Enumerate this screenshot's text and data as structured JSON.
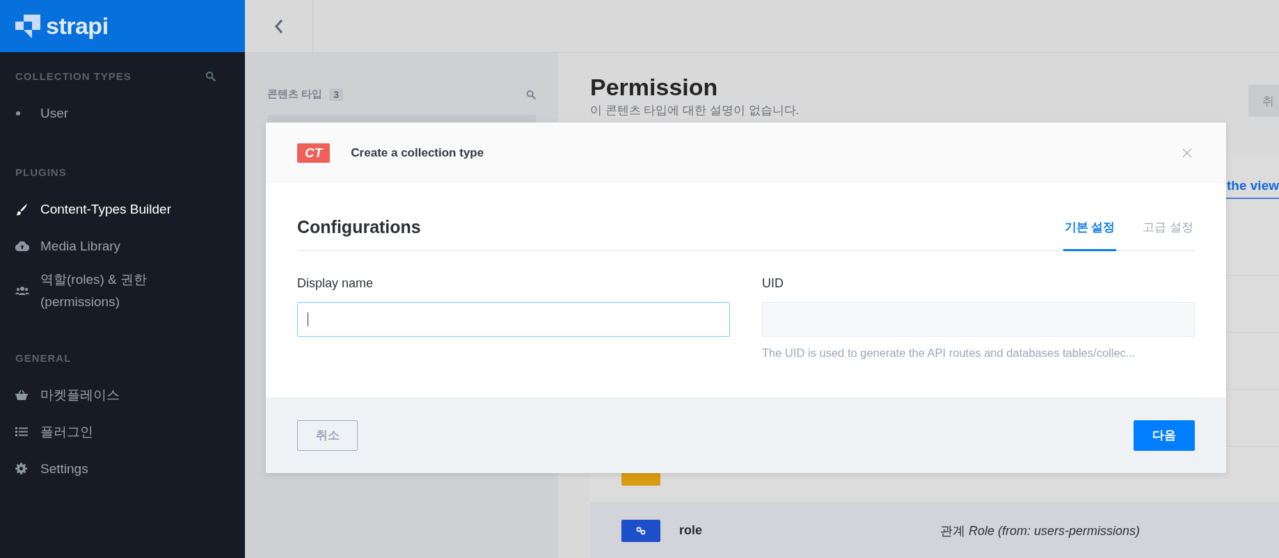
{
  "sidebar": {
    "logo": "strapi",
    "sections": [
      {
        "title": "COLLECTION TYPES",
        "searchable": true,
        "items": [
          {
            "label": "User",
            "kind": "bullet",
            "selected": false
          }
        ]
      },
      {
        "title": "PLUGINS",
        "searchable": false,
        "items": [
          {
            "label": "Content-Types Builder",
            "kind": "brush",
            "selected": true
          },
          {
            "label": "Media Library",
            "kind": "cloud",
            "selected": false
          },
          {
            "label": "역할(roles) & 권한 (permissions)",
            "kind": "users",
            "selected": false
          }
        ]
      },
      {
        "title": "GENERAL",
        "searchable": false,
        "items": [
          {
            "label": "마켓플레이스",
            "kind": "basket",
            "selected": false
          },
          {
            "label": "플러그인",
            "kind": "list",
            "selected": false
          },
          {
            "label": "Settings",
            "kind": "gear",
            "selected": false
          }
        ]
      }
    ]
  },
  "types_panel": {
    "title": "콘텐츠 타입",
    "count": "3"
  },
  "page": {
    "title": "Permission",
    "subtitle": "이 콘텐츠 타입에 대한 설명이 없습니다.",
    "button": "취",
    "link": "the view",
    "fields": [
      {
        "kind": "text",
        "selected": false
      },
      {
        "kind": "relation",
        "name": "role",
        "type": "관계 *Role (from: users-permissions)*",
        "selected": true
      }
    ]
  },
  "modal": {
    "badge": "CT",
    "title": "Create a collection type",
    "heading": "Configurations",
    "tabs": [
      {
        "label": "기본 설정",
        "selected": true
      },
      {
        "label": "고급 설정",
        "selected": false
      }
    ],
    "display_name": {
      "label": "Display name",
      "focused": true
    },
    "uid": {
      "label": "UID",
      "hint": "The UID is used to generate the API routes and databases tables/collec..."
    },
    "buttons": {
      "cancel": "취소",
      "next": "다음"
    }
  }
}
